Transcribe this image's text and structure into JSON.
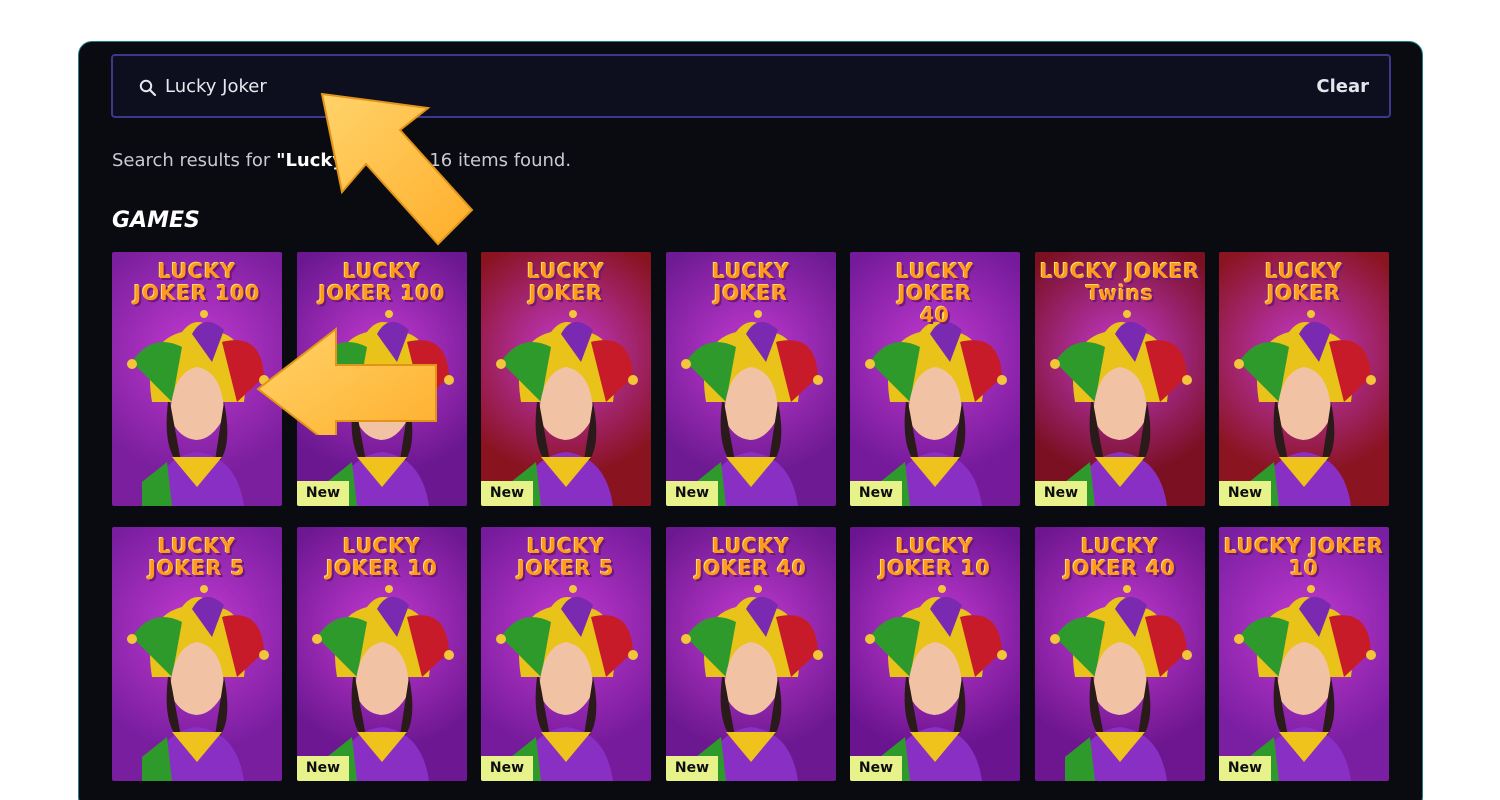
{
  "search": {
    "value": "Lucky Joker",
    "clear_label": "Clear"
  },
  "results": {
    "prefix": "Search results for ",
    "query": "\"Lucky Joker\"",
    "suffix": " - 16 items found."
  },
  "section": {
    "title": "GAMES"
  },
  "games": [
    {
      "title": "LUCKY\nJOKER 100",
      "new": false,
      "bg": "#7b1f9e"
    },
    {
      "title": "LUCKY\nJOKER 100",
      "new": true,
      "badge": "New",
      "bg": "#6a1790"
    },
    {
      "title": "LUCKY\nJOKER",
      "new": true,
      "badge": "New",
      "bg": "#8a1320"
    },
    {
      "title": "LUCKY\nJOKER",
      "new": true,
      "badge": "New",
      "bg": "#6e1a93"
    },
    {
      "title": "LUCKY\nJOKER\n40",
      "new": true,
      "badge": "New",
      "bg": "#741a9a"
    },
    {
      "title": "LUCKY JOKER\nTwins",
      "new": true,
      "badge": "New",
      "bg": "#7a1022"
    },
    {
      "title": "LUCKY\nJOKER",
      "new": true,
      "badge": "New",
      "bg": "#8a1420"
    },
    {
      "title": "LUCKY\nJOKER 5",
      "new": false,
      "bg": "#7a1ea0"
    },
    {
      "title": "LUCKY\nJOKER 10",
      "new": true,
      "badge": "New",
      "bg": "#6d1792"
    },
    {
      "title": "LUCKY\nJOKER 5",
      "new": true,
      "badge": "New",
      "bg": "#761b9c"
    },
    {
      "title": "LUCKY\nJOKER 40",
      "new": true,
      "badge": "New",
      "bg": "#6c1890"
    },
    {
      "title": "LUCKY\nJOKER 10",
      "new": true,
      "badge": "New",
      "bg": "#6a1490"
    },
    {
      "title": "LUCKY\nJOKER 40",
      "new": false,
      "bg": "#6e168f"
    },
    {
      "title": "LUCKY JOKER 10",
      "new": true,
      "badge": "New",
      "bg": "#7a1ea2"
    }
  ],
  "colors": {
    "panel_bg": "#0a0b10",
    "accent_border": "#3f3690",
    "badge": "#e8f28a",
    "arrow": "#ffb93a"
  }
}
